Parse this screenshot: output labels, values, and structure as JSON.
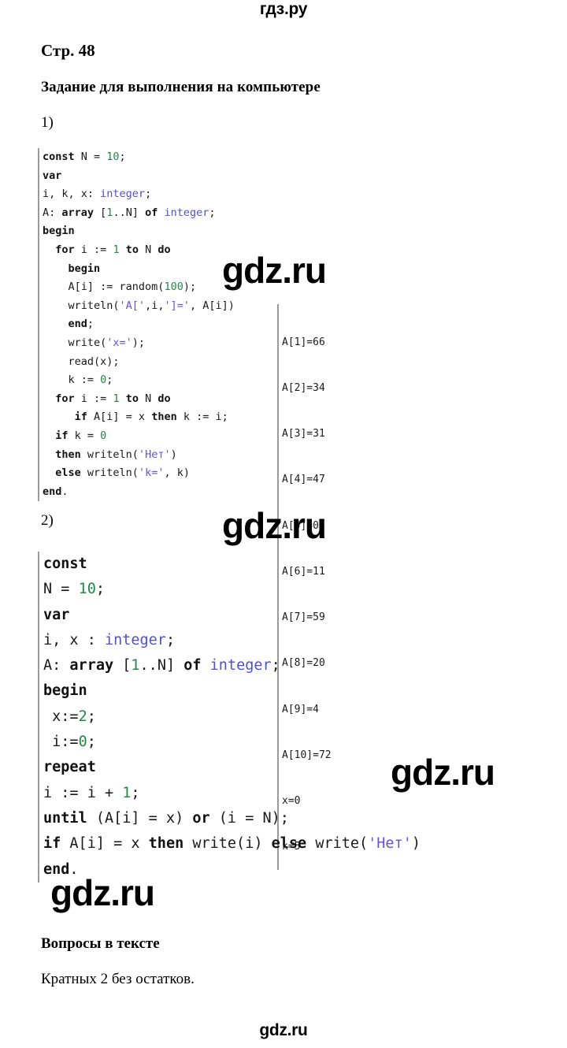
{
  "site": {
    "watermark": "gdz.ru",
    "top_mark": "гдз.ру",
    "bottom_mark": "gdz.ru"
  },
  "document": {
    "page_title": "Стр. 48",
    "section_heading": "Задание для выполнения на компьютере",
    "item_1_label": "1)",
    "item_2_label": "2)",
    "questions_heading": "Вопросы в тексте",
    "questions_answer": "Кратных 2 без остатков."
  },
  "code_block_1": {
    "language": "pascal",
    "lines": [
      "const N = 10;",
      "var",
      "i, k, x: integer;",
      "A: array [1..N] of integer;",
      "begin",
      "  for i := 1 to N do",
      "    begin",
      "    A[i] := random(100);",
      "    writeln('A[',i,']=', A[i])",
      "    end;",
      "    write('x=');",
      "    read(x);",
      "    k := 0;",
      "  for i := 1 to N do",
      "     if A[i] = x then k := i;",
      "  if k = 0",
      "  then writeln('Нет')",
      "  else writeln('k=', k)",
      "end."
    ]
  },
  "console_output": {
    "lines": [
      "A[1]=66",
      "A[2]=34",
      "A[3]=31",
      "A[4]=47",
      "A[5]=0",
      "A[6]=11",
      "A[7]=59",
      "A[8]=20",
      "A[9]=4",
      "A[10]=72",
      "x=0",
      "k=5"
    ],
    "array_values": [
      66,
      34,
      31,
      47,
      0,
      11,
      59,
      20,
      4,
      72
    ],
    "x_value": 0,
    "k_value": 5
  },
  "code_block_2": {
    "language": "pascal",
    "lines": [
      "const",
      "N = 10;",
      "var",
      "i, x : integer;",
      "A: array [1..N] of integer;",
      "begin",
      " x:=2;",
      " i:=0;",
      "repeat",
      "i := i + 1;",
      "until (A[i] = x) or (i = N);",
      "if A[i] = x then write(i) else write('Нет')",
      "end."
    ]
  },
  "colors": {
    "keyword": "#111111",
    "type": "#4f4fd4",
    "number": "#1f8a45",
    "string": "#6a4fe0",
    "gutter": "#9a9a9a",
    "background": "#ffffff"
  }
}
